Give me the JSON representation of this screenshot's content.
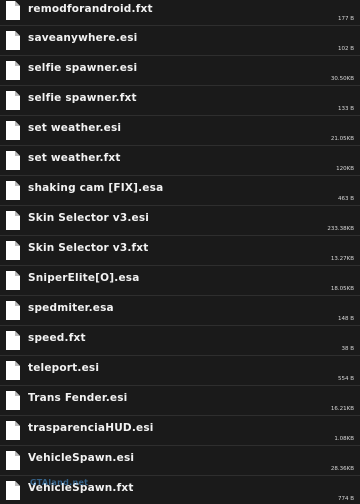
{
  "icons": {
    "file": "file-icon"
  },
  "files": [
    {
      "name": "remodforandroid.fxt",
      "size": "177 B"
    },
    {
      "name": "saveanywhere.esi",
      "size": "102 B"
    },
    {
      "name": "selfie spawner.esi",
      "size": "30.50KB"
    },
    {
      "name": "selfie spawner.fxt",
      "size": "133 B"
    },
    {
      "name": "set weather.esi",
      "size": "21.05KB"
    },
    {
      "name": "set weather.fxt",
      "size": "120KB"
    },
    {
      "name": "shaking cam [FIX].esa",
      "size": "463 B"
    },
    {
      "name": "Skin Selector v3.esi",
      "size": "233.38KB"
    },
    {
      "name": "Skin Selector v3.fxt",
      "size": "13.27KB"
    },
    {
      "name": "SniperElite[O].esa",
      "size": "18.05KB"
    },
    {
      "name": "spedmiter.esa",
      "size": "148 B"
    },
    {
      "name": "speed.fxt",
      "size": "38 B"
    },
    {
      "name": "teleport.esi",
      "size": "554 B"
    },
    {
      "name": "Trans Fender.esi",
      "size": "16.21KB"
    },
    {
      "name": "trasparenciaHUD.esi",
      "size": "1.08KB"
    },
    {
      "name": "VehicleSpawn.esi",
      "size": "28.36KB"
    },
    {
      "name": "VehicleSpawn.fxt",
      "size": "774 B"
    }
  ],
  "watermark": "GTAland.net",
  "colors": {
    "background": "#1a1a1a",
    "icon": "#ffffff",
    "divider": "#2e2e2e"
  }
}
